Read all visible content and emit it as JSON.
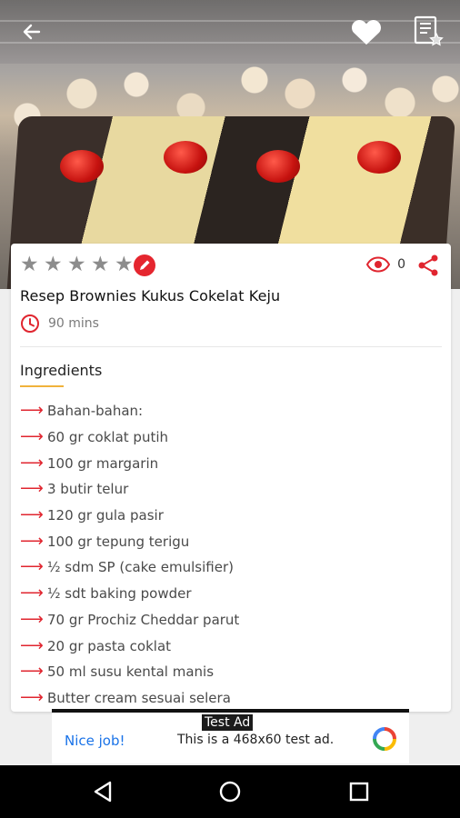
{
  "recipe": {
    "title": "Resep Brownies Kukus Cokelat Keju",
    "time": "90 mins",
    "views": "0",
    "rating_stars": 5,
    "rating_value": 0
  },
  "ingredients": {
    "heading": "Ingredients",
    "items": [
      "Bahan-bahan:",
      "60 gr coklat putih",
      "100 gr margarin",
      "3 butir telur",
      "120 gr gula pasir",
      "100 gr tepung terigu",
      "½ sdm SP (cake emulsifier)",
      "½ sdt baking powder",
      "70 gr Prochiz Cheddar parut",
      "20 gr pasta coklat",
      "50 ml susu kental manis",
      "Butter cream sesuai selera"
    ]
  },
  "ad": {
    "label": "Test Ad",
    "nice": "Nice job!",
    "text": "This is a 468x60 test ad."
  },
  "icons": {
    "back": "arrow-left-icon",
    "favorite": "heart-icon",
    "bookmark": "bookmark-list-icon",
    "edit": "pencil-icon",
    "views": "eye-icon",
    "share": "share-icon",
    "time": "clock-icon",
    "ingredient_bullet": "arrow-right-icon"
  },
  "colors": {
    "accent_red": "#e0252f",
    "ingredient_underline": "#f0b23b",
    "ad_link": "#1a73e8"
  }
}
